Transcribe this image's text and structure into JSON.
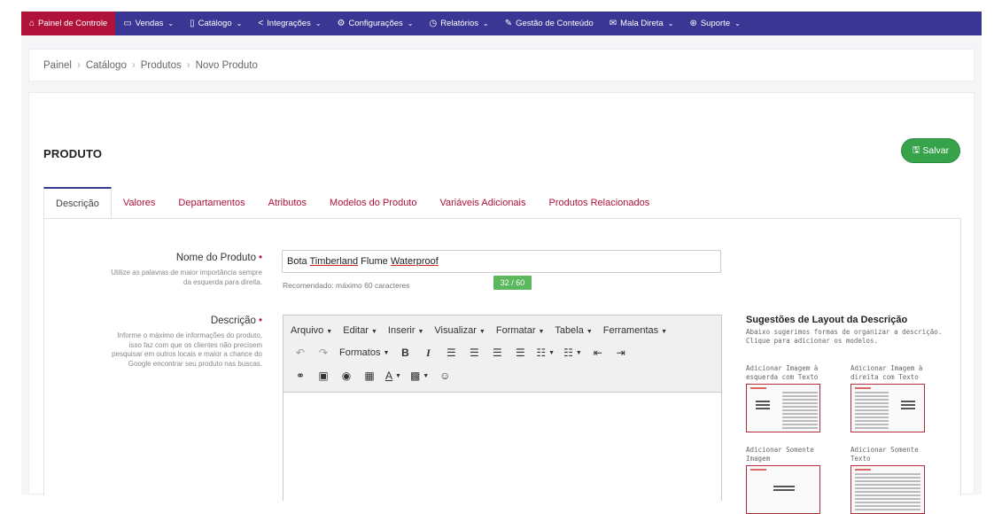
{
  "nav": {
    "items": [
      {
        "label": "Painel de Controle",
        "icon": "home-icon",
        "glyph": "⌂",
        "caret": false,
        "active": true
      },
      {
        "label": "Vendas",
        "icon": "cart-icon",
        "glyph": "▭",
        "caret": true
      },
      {
        "label": "Catálogo",
        "icon": "book-icon",
        "glyph": "▯",
        "caret": true
      },
      {
        "label": "Integrações",
        "icon": "share-icon",
        "glyph": "<",
        "caret": true
      },
      {
        "label": "Configurações",
        "icon": "gear-icon",
        "glyph": "⚙",
        "caret": true
      },
      {
        "label": "Relatórios",
        "icon": "clock-icon",
        "glyph": "◷",
        "caret": true
      },
      {
        "label": "Gestão de Conteúdo",
        "icon": "edit-icon",
        "glyph": "✎",
        "caret": false
      },
      {
        "label": "Mala Direta",
        "icon": "envelope-icon",
        "glyph": "✉",
        "caret": true
      },
      {
        "label": "Suporte",
        "icon": "support-icon",
        "glyph": "⊛",
        "caret": true
      }
    ]
  },
  "breadcrumb": [
    "Painel",
    "Catálogo",
    "Produtos",
    "Novo Produto"
  ],
  "card": {
    "title": "PRODUTO",
    "save_label": "Salvar"
  },
  "tabs": [
    "Descrição",
    "Valores",
    "Departamentos",
    "Atributos",
    "Modelos do Produto",
    "Variáveis Adicionais",
    "Produtos Relacionados"
  ],
  "active_tab": 0,
  "name_field": {
    "label": "Nome do Produto",
    "required_mark": "•",
    "help": [
      "Utilize as palavras de maior importância sempre",
      "da esquerda para direita."
    ],
    "value_parts": [
      {
        "text": "Bota ",
        "flag": false
      },
      {
        "text": "Timberland",
        "flag": true
      },
      {
        "text": " Flume ",
        "flag": false
      },
      {
        "text": "Waterproof",
        "flag": true
      }
    ],
    "recommendation": "Recomendado: máximo 60 caracteres",
    "counter": "32 / 60"
  },
  "desc_field": {
    "label": "Descrição",
    "required_mark": "•",
    "help": [
      "Informe o máximo de informações do produto,",
      "isso faz com que os clientes não precisem",
      "pesquisar em outros locais e maior a chance do",
      "Google encontrar seu produto nas buscas."
    ]
  },
  "editor": {
    "menus": [
      "Arquivo",
      "Editar",
      "Inserir",
      "Visualizar",
      "Formatar",
      "Tabela",
      "Ferramentas"
    ],
    "formats_label": "Formatos",
    "toolbar_row1": [
      {
        "name": "undo-icon",
        "glyph": "↶",
        "gray": true
      },
      {
        "name": "redo-icon",
        "glyph": "↷",
        "gray": true
      },
      {
        "name": "formats-dropdown",
        "glyph": "Formatos",
        "wide": true,
        "caret": true
      },
      {
        "name": "bold-icon",
        "glyph": "B",
        "bold": true
      },
      {
        "name": "italic-icon",
        "glyph": "I",
        "italic": true
      },
      {
        "name": "align-left-icon",
        "glyph": "☰"
      },
      {
        "name": "align-center-icon",
        "glyph": "☰"
      },
      {
        "name": "align-right-icon",
        "glyph": "☰"
      },
      {
        "name": "align-justify-icon",
        "glyph": "☰"
      },
      {
        "name": "bullet-list-icon",
        "glyph": "☷",
        "caret": true
      },
      {
        "name": "numbered-list-icon",
        "glyph": "☷",
        "caret": true
      },
      {
        "name": "outdent-icon",
        "glyph": "⇤"
      },
      {
        "name": "indent-icon",
        "glyph": "⇥"
      }
    ],
    "toolbar_row2": [
      {
        "name": "link-icon",
        "glyph": "⚭"
      },
      {
        "name": "image-icon",
        "glyph": "▣"
      },
      {
        "name": "preview-icon",
        "glyph": "◉"
      },
      {
        "name": "media-icon",
        "glyph": "▦"
      },
      {
        "name": "text-color-icon",
        "glyph": "A",
        "underline": true,
        "caret": true
      },
      {
        "name": "background-color-icon",
        "glyph": "▩",
        "caret": true
      },
      {
        "name": "emoticon-icon",
        "glyph": "☺"
      }
    ]
  },
  "suggestions": {
    "title": "Sugestões de Layout da Descrição",
    "description": "Abaixo sugerimos formas de organizar a descrição. Clique para adicionar os modelos.",
    "items": [
      {
        "label": "Adicionar Imagem à esquerda com Texto",
        "variant": "image-left"
      },
      {
        "label": "Adicionar Imagem à direita com Texto",
        "variant": "image-right"
      },
      {
        "label": "Adicionar Somente Imagem",
        "variant": "image-only"
      },
      {
        "label": "Adicionar Somente Texto",
        "variant": "text-only"
      }
    ]
  },
  "colors": {
    "nav_bg": "#3a3693",
    "nav_active": "#b0123a",
    "save_green": "#36a34b",
    "tab_link": "#b0123a",
    "counter_green": "#5cb85c"
  }
}
